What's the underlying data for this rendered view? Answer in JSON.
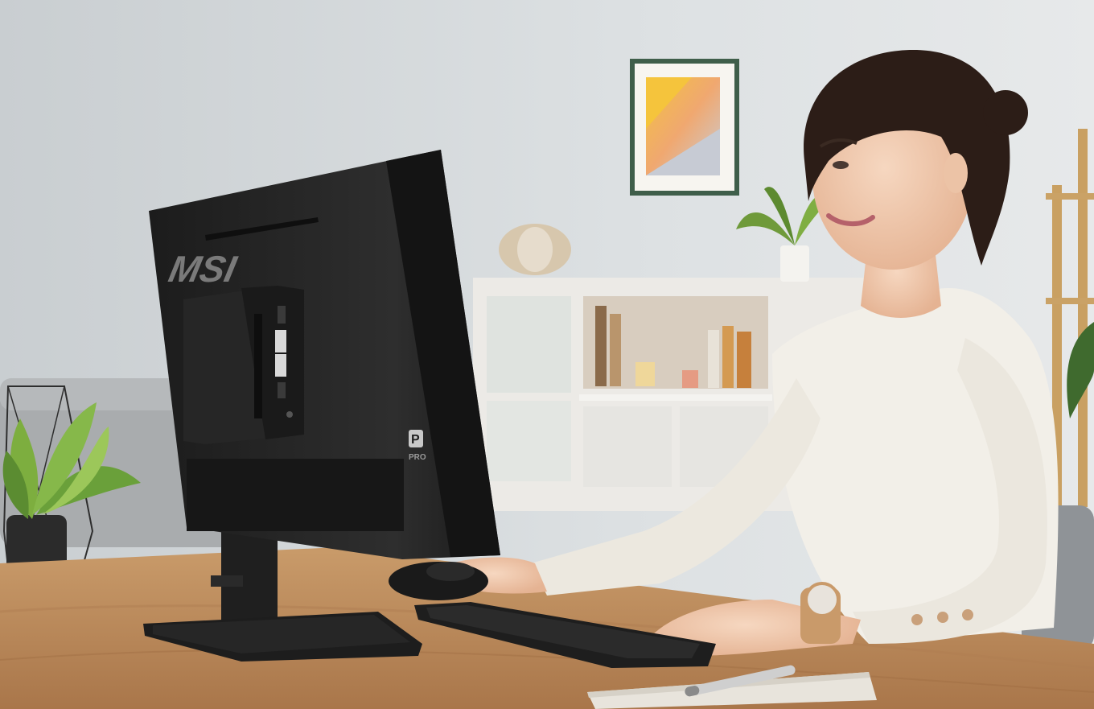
{
  "scene": {
    "monitor_logo_text": "MSI",
    "monitor_badge_letter": "P",
    "monitor_badge_text": "PRO",
    "colors": {
      "wall": "#d8dde0",
      "floor": "#cfc6bb",
      "desk": "#b98a5e",
      "monitor": "#242424",
      "sweater": "#f2efe8",
      "skin": "#f0c9ae",
      "hair": "#2c1d17",
      "plant": "#6aa03a"
    }
  }
}
